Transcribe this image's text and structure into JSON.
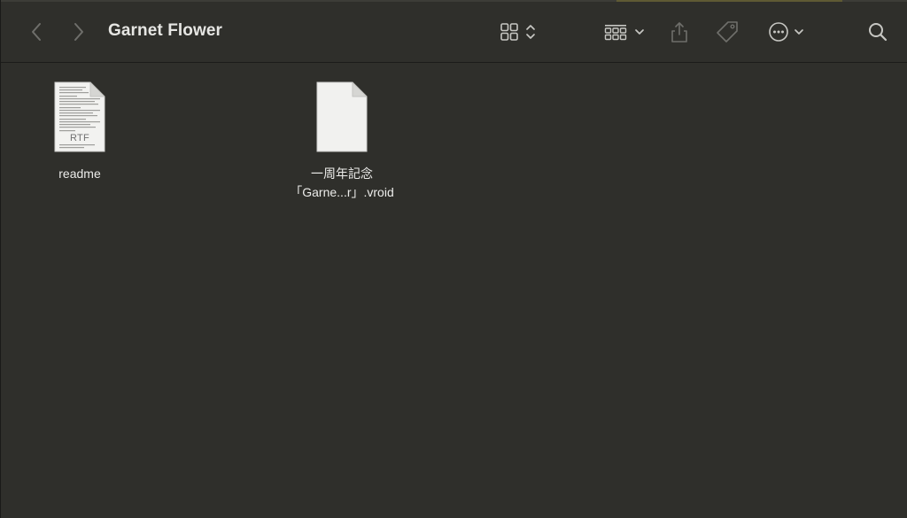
{
  "window": {
    "title": "Garnet Flower"
  },
  "toolbar": {
    "back_icon": "chevron-left-icon",
    "forward_icon": "chevron-right-icon",
    "view_icon": "grid-view-icon",
    "group_icon": "group-by-icon",
    "share_icon": "share-icon",
    "tag_icon": "tag-icon",
    "more_icon": "ellipsis-circle-icon",
    "search_icon": "search-icon"
  },
  "files": [
    {
      "name": "readme",
      "kind_label": "RTF",
      "icon": "rtf-document-icon"
    },
    {
      "name_line1": "一周年記念",
      "name_line2": "「Garne...r」.vroid",
      "icon": "generic-document-icon"
    }
  ],
  "colors": {
    "background": "#2f2f2b",
    "text": "#ececea",
    "icon_gray": "#9a9a96"
  }
}
